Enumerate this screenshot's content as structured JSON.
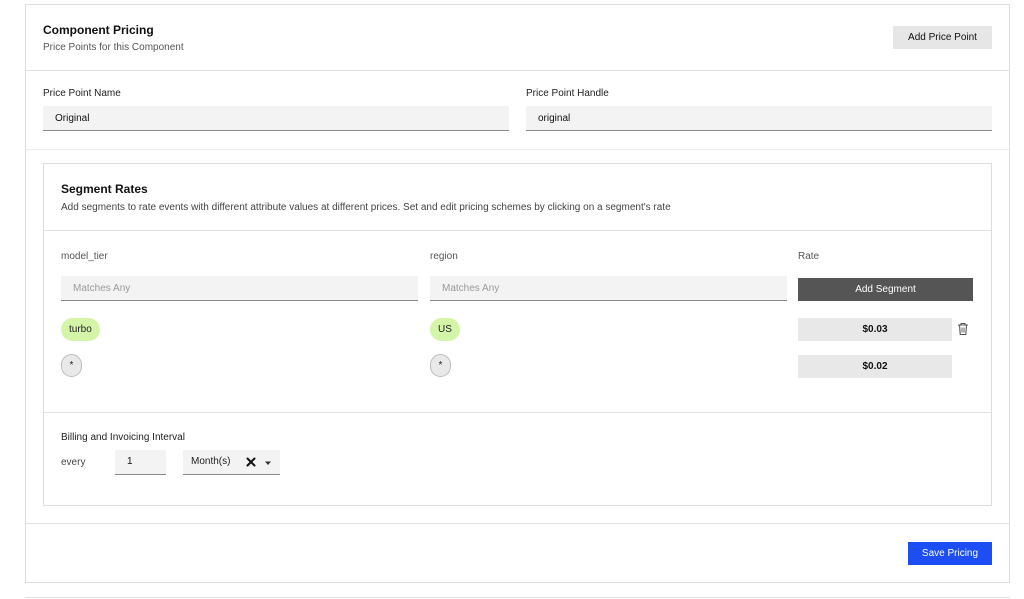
{
  "header": {
    "title": "Component Pricing",
    "subtitle": "Price Points for this Component",
    "add_price_point_label": "Add Price Point"
  },
  "price_point": {
    "name_label": "Price Point Name",
    "name_value": "Original",
    "handle_label": "Price Point Handle",
    "handle_value": "original"
  },
  "segment_rates": {
    "title": "Segment Rates",
    "subtitle": "Add segments to rate events with different attribute values at different prices. Set and edit pricing schemes by clicking on a segment's rate",
    "columns": [
      "model_tier",
      "region",
      "Rate"
    ],
    "filter_placeholder_1": "Matches Any",
    "filter_placeholder_2": "Matches Any",
    "add_segment_label": "Add Segment",
    "rows": [
      {
        "model_tier": "turbo",
        "region": "US",
        "rate": "$0.03",
        "has_delete": true
      },
      {
        "model_tier": "*",
        "region": "*",
        "rate": "$0.02",
        "has_delete": false
      }
    ]
  },
  "billing": {
    "title": "Billing and Invoicing Interval",
    "every_label": "every",
    "interval_value": "1",
    "interval_unit": "Month(s)"
  },
  "footer": {
    "save_label": "Save Pricing"
  },
  "icons": {
    "delete": "trash-icon",
    "clear": "close-icon",
    "dropdown": "chevron-down-icon"
  },
  "colors": {
    "primary_button": "#1d4ef5",
    "segment_button": "#555555",
    "pill_green": "#d4f4a8",
    "pill_gray": "#e9e9e9"
  }
}
